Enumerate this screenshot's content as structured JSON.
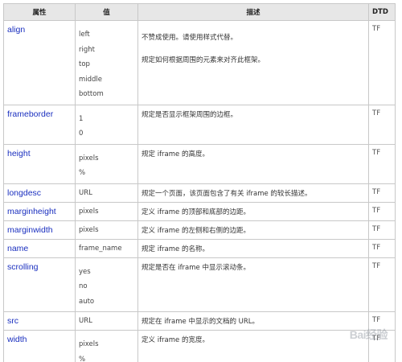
{
  "table": {
    "headers": {
      "attribute": "属性",
      "value": "值",
      "description": "描述",
      "dtd": "DTD"
    },
    "rows": [
      {
        "name": "align",
        "values": [
          "left",
          "right",
          "top",
          "middle",
          "bottom"
        ],
        "description": [
          "不赞成使用。请使用样式代替。",
          "规定如何根据周围的元素来对齐此框架。"
        ],
        "dtd": "TF"
      },
      {
        "name": "frameborder",
        "values": [
          "1",
          "0"
        ],
        "description": [
          "规定是否显示框架周围的边框。"
        ],
        "dtd": "TF"
      },
      {
        "name": "height",
        "values": [
          "pixels",
          "%"
        ],
        "description": [
          "规定 iframe 的高度。"
        ],
        "dtd": "TF"
      },
      {
        "name": "longdesc",
        "values": [
          "URL"
        ],
        "description": [
          "规定一个页面，该页面包含了有关 iframe 的较长描述。"
        ],
        "dtd": "TF"
      },
      {
        "name": "marginheight",
        "values": [
          "pixels"
        ],
        "description": [
          "定义 iframe 的顶部和底部的边距。"
        ],
        "dtd": "TF"
      },
      {
        "name": "marginwidth",
        "values": [
          "pixels"
        ],
        "description": [
          "定义 iframe 的左侧和右侧的边距。"
        ],
        "dtd": "TF"
      },
      {
        "name": "name",
        "values": [
          "frame_name"
        ],
        "description": [
          "规定 iframe 的名称。"
        ],
        "dtd": "TF"
      },
      {
        "name": "scrolling",
        "values": [
          "yes",
          "no",
          "auto"
        ],
        "description": [
          "规定是否在 iframe 中显示滚动条。"
        ],
        "dtd": "TF"
      },
      {
        "name": "src",
        "values": [
          "URL"
        ],
        "description": [
          "规定在 iframe 中显示的文档的 URL。"
        ],
        "dtd": "TF"
      },
      {
        "name": "width",
        "values": [
          "pixels",
          "%"
        ],
        "description": [
          "定义 iframe 的宽度。"
        ],
        "dtd": "TF"
      }
    ]
  },
  "watermark": {
    "text": "Bai经验",
    "sub": "经验"
  }
}
